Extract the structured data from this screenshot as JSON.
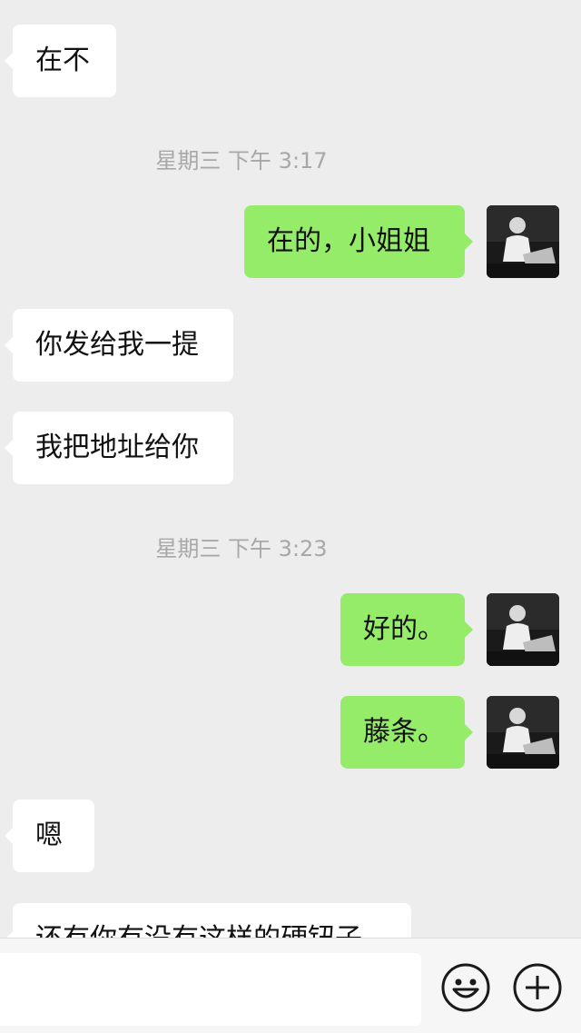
{
  "messages": [
    {
      "text": "在不"
    },
    {
      "text": "在的，小姐姐"
    },
    {
      "text": "你发给我一提"
    },
    {
      "text": "我把地址给你"
    },
    {
      "text": "好的。"
    },
    {
      "text": "藤条。"
    },
    {
      "text": "嗯"
    },
    {
      "text": "还有你有没有这样的硬钮子"
    }
  ],
  "timestamps": [
    {
      "text": "星期三 下午 3:17"
    },
    {
      "text": "星期三 下午 3:23"
    }
  ],
  "composer": {
    "value": "",
    "placeholder": "",
    "emoji_icon": "emoji-smile-icon",
    "plus_icon": "plus-circle-icon"
  },
  "colors": {
    "background": "#ededed",
    "incoming_bubble": "#ffffff",
    "outgoing_bubble": "#95ec69",
    "timestamp_text": "#a8a8a8"
  }
}
